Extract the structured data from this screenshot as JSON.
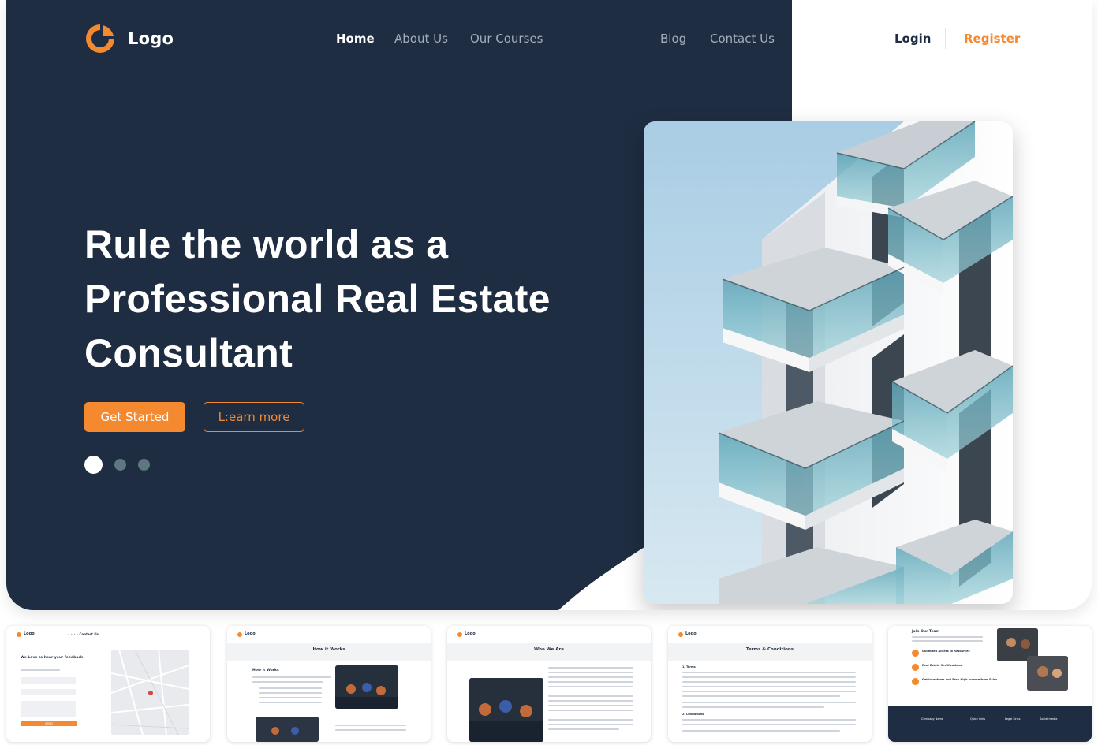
{
  "brand": {
    "logo_text": "Logo",
    "accent": "#f48930",
    "navy": "#1f2d42"
  },
  "nav": {
    "items": [
      "Home",
      "About Us",
      "Our Courses",
      "Blog",
      "Contact Us"
    ],
    "active": "Home"
  },
  "auth": {
    "login": "Login",
    "register": "Register"
  },
  "hero": {
    "headline_lines": [
      "Rule the world as a",
      "Professional Real Estate",
      "Consultant"
    ],
    "primary_cta": "Get Started",
    "secondary_cta": "L:earn more",
    "carousel": {
      "count": 3,
      "active_index": 0
    },
    "image": "modern-building-balconies-photo"
  },
  "thumbnails": [
    {
      "page": "contact",
      "logo": "Logo",
      "heading": "We Love to hear your feedback",
      "nav_active": "Contact Us",
      "button": "SEND"
    },
    {
      "page": "how-it-works",
      "logo": "Logo",
      "title": "How it Works",
      "section": "How it Works",
      "nav_active": "Our Courses"
    },
    {
      "page": "about",
      "logo": "Logo",
      "title": "Who We Are",
      "nav_active": "About Us"
    },
    {
      "page": "terms",
      "logo": "Logo",
      "title": "Terms & Conditions",
      "sections": [
        "1. Terms",
        "2. Limitations"
      ]
    },
    {
      "page": "join",
      "heading": "Join Our Team",
      "features": [
        "Unlimited Access to Resources",
        "Real Estate Certifications",
        "Get Incentives and Earn High Income from Sales"
      ],
      "footer_cols": [
        "Company Name",
        "Quick links",
        "Legal Links",
        "Social media"
      ]
    }
  ]
}
